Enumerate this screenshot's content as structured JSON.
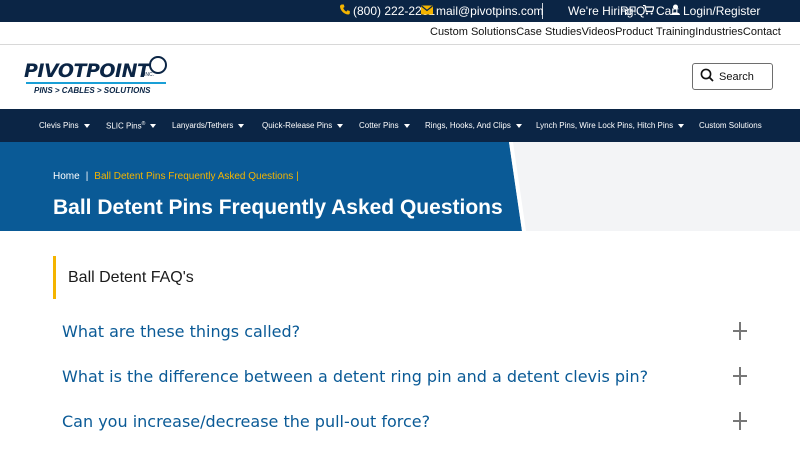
{
  "topbar": {
    "phone": "(800) 222-2231",
    "email": "mail@pivotpins.com",
    "hiring": "We're Hiring!",
    "rfq": "RFQ",
    "cart": "Cart",
    "login": "Login/Register",
    "icons": {
      "phone": "phone-icon",
      "mail": "mail-icon",
      "cart": "cart-icon",
      "user": "user-icon"
    }
  },
  "secondary_nav": [
    "Custom Solutions",
    "Case Studies",
    "Videos",
    "Product Training",
    "Industries",
    "Contact"
  ],
  "logo": {
    "word": "PIVOTPOINT",
    "inc": "INC.",
    "tagline": "PINS > CABLES > SOLUTIONS"
  },
  "search": {
    "label": "Search"
  },
  "main_nav": [
    {
      "label": "Clevis Pins",
      "dropdown": true
    },
    {
      "label": "SLIC Pins",
      "sup": "®",
      "dropdown": true
    },
    {
      "label": "Lanyards/Tethers",
      "dropdown": true
    },
    {
      "label": "Quick-Release Pins",
      "dropdown": true
    },
    {
      "label": "Cotter Pins",
      "dropdown": true
    },
    {
      "label": "Rings, Hooks, And Clips",
      "dropdown": true
    },
    {
      "label": "Lynch Pins, Wire Lock Pins, Hitch Pins",
      "dropdown": true
    },
    {
      "label": "Custom Solutions",
      "dropdown": false
    }
  ],
  "breadcrumb": {
    "home": "Home",
    "sep": "|",
    "current": "Ball Detent Pins Frequently Asked Questions",
    "trail": "|"
  },
  "hero": {
    "title": "Ball Detent Pins Frequently Asked Questions"
  },
  "faq": {
    "heading": "Ball Detent FAQ's",
    "questions": [
      "What are these things called?",
      "What is the difference between a detent ring pin and a detent clevis pin?",
      "Can you increase/decrease the pull-out force?"
    ]
  },
  "colors": {
    "navy": "#0b2545",
    "blue": "#0a5a96",
    "accent": "#f4b400",
    "light": "#1a9fd6"
  }
}
